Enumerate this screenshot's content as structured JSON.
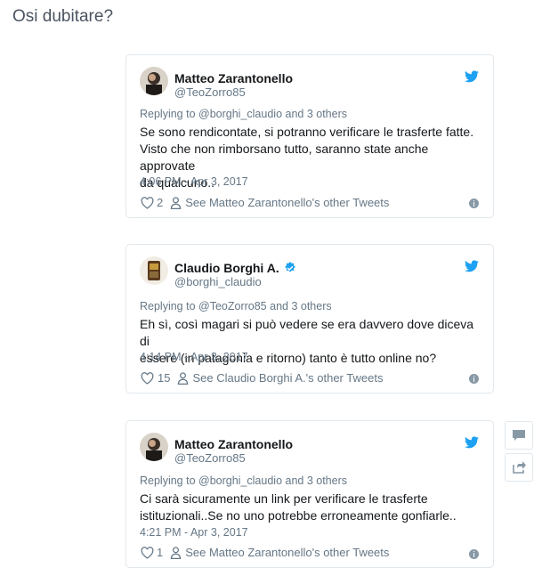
{
  "page": {
    "title": "Osi dubitare?"
  },
  "tweets": [
    {
      "name": "Matteo Zarantonello",
      "handle": "@TeoZorro85",
      "verified": false,
      "reply_prefix": "Replying to ",
      "reply_user": "@borghi_claudio",
      "reply_suffix": " and 3 others",
      "text_lines": [
        "Se sono rendicontate, si potranno verificare le trasferte fatte.",
        "Visto che non rimborsano tutto, saranno state anche approvate",
        "da qualcuno.."
      ],
      "timestamp": "4:06 PM - Apr 3, 2017",
      "likes": "2",
      "see_other": "See Matteo Zarantonello's other Tweets"
    },
    {
      "name": "Claudio Borghi A.",
      "handle": "@borghi_claudio",
      "verified": true,
      "reply_prefix": "Replying to ",
      "reply_user": "@TeoZorro85",
      "reply_suffix": " and 3 others",
      "text_lines": [
        "Eh sì, così magari si può vedere se era davvero dove diceva di",
        "essere (in patagonia e ritorno) tanto è tutto online no?"
      ],
      "timestamp": "4:14 PM - Apr 3, 2017",
      "likes": "15",
      "see_other": "See Claudio Borghi A.'s other Tweets"
    },
    {
      "name": "Matteo Zarantonello",
      "handle": "@TeoZorro85",
      "verified": false,
      "reply_prefix": "Replying to ",
      "reply_user": "@borghi_claudio",
      "reply_suffix": " and 3 others",
      "text_lines": [
        "Ci sarà sicuramente un link per verificare le trasferte",
        "istituzionali..Se no uno potrebbe erroneamente gonfiarle.."
      ],
      "timestamp": "4:21 PM - Apr 3, 2017",
      "likes": "1",
      "see_other": "See Matteo Zarantonello's other Tweets"
    }
  ],
  "colors": {
    "twitter_blue": "#1da1f2",
    "text": "#14171a",
    "muted": "#657786",
    "border": "#e1e8ed"
  },
  "icons": [
    "twitter-bird-icon",
    "verified-badge-icon",
    "heart-icon",
    "person-icon",
    "info-icon",
    "comment-icon",
    "share-icon"
  ]
}
